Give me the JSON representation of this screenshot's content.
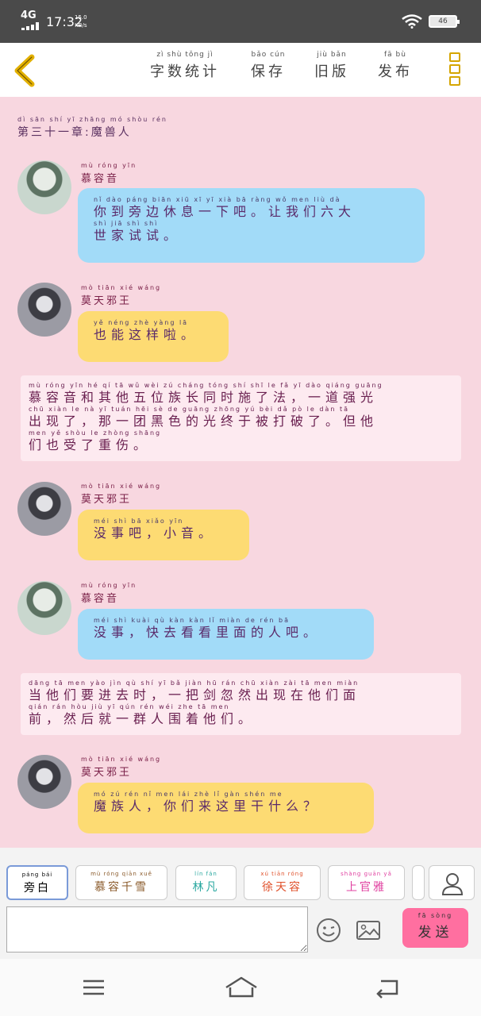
{
  "status_bar": {
    "network": "4G",
    "time": "17:32",
    "speed_value": "15.0",
    "speed_unit": "KB/s",
    "battery": "46"
  },
  "toolbar": {
    "items": [
      {
        "pinyin": "zì  shù  tǒng  jì",
        "label": "字数统计"
      },
      {
        "pinyin": "bǎo  cún",
        "label": "保存"
      },
      {
        "pinyin": "jiù  bǎn",
        "label": "旧版"
      },
      {
        "pinyin": "fā  bù",
        "label": "发布"
      }
    ]
  },
  "chapter": {
    "pinyin": "dì  sān  shí  yī  zhāng  mó  shòu  rén",
    "title": "第三十一章:魔兽人"
  },
  "messages": [
    {
      "speaker_pinyin": "mù  róng  yīn",
      "speaker": "慕容音",
      "lines": [
        {
          "pinyin": "nǐ  dào  páng  biān  xiū  xī  yī  xià  bā    ràng  wǒ  men  liù  dà",
          "text": "你到旁边休息一下吧。让我们六大"
        },
        {
          "pinyin": "shì  jiā  shì  shì",
          "text": "世家试试。"
        }
      ]
    },
    {
      "speaker_pinyin": "mò  tiān  xié  wáng",
      "speaker": "莫天邪王",
      "lines": [
        {
          "pinyin": "yě  néng  zhè  yàng  lā",
          "text": "也能这样啦。"
        }
      ]
    },
    {
      "speaker_pinyin": "mò  tiān  xié  wáng",
      "speaker": "莫天邪王",
      "lines": [
        {
          "pinyin": "méi  shì  bā    xiǎo  yīn",
          "text": "没事吧，小音。"
        }
      ]
    },
    {
      "speaker_pinyin": "mù  róng  yīn",
      "speaker": "慕容音",
      "lines": [
        {
          "pinyin": "méi  shì    kuài  qù  kàn  kàn  lǐ  miàn  de  rén  bā",
          "text": "没事，快去看看里面的人吧。"
        }
      ]
    },
    {
      "speaker_pinyin": "mò  tiān  xié  wáng",
      "speaker": "莫天邪王",
      "lines": [
        {
          "pinyin": "mó  zú  rén    nǐ  men  lái  zhè  lǐ  gàn  shén  me",
          "text": "魔族人，你们来这里干什么？"
        }
      ]
    }
  ],
  "narrations": [
    {
      "lines": [
        {
          "pinyin": "mù  róng  yīn  hé  qí  tā  wǔ  wèi  zú  cháng tóng  shí  shī  le  fǎ    yī  dào  qiáng guāng",
          "text": "慕容音和其他五位族长同时施了法，一道强光"
        },
        {
          "pinyin": "chū  xiàn  le    nà  yī  tuán  hēi  sè  de  guāng zhōng  yú  bèi  dǎ  pò  le    dàn  tā",
          "text": "出现了，那一团黑色的光终于被打破了。但他"
        },
        {
          "pinyin": "men  yě  shòu  le  zhòng shāng",
          "text": "们也受了重伤。"
        }
      ]
    },
    {
      "lines": [
        {
          "pinyin": "dāng  tā  men  yào  jìn  qù  shí    yī  bǎ  jiàn  hū  rán  chū  xiàn  zài  tā  men  miàn",
          "text": "当他们要进去时，一把剑忽然出现在他们面"
        },
        {
          "pinyin": "qián    rán  hòu  jiù  yī  qún  rén  wéi  zhe  tā  men",
          "text": "前，然后就一群人围着他们。"
        }
      ]
    }
  ],
  "roles": [
    {
      "pinyin": "páng  bái",
      "label": "旁白",
      "color": "#333333"
    },
    {
      "pinyin": "mù  róng  qiān  xuě",
      "label": "慕容千雪",
      "color": "#8a5a2a"
    },
    {
      "pinyin": "lín  fán",
      "label": "林凡",
      "color": "#2aa8a0"
    },
    {
      "pinyin": "xú  tiān  róng",
      "label": "徐天容",
      "color": "#e0502a"
    },
    {
      "pinyin": "shàng guān  yǎ",
      "label": "上官雅",
      "color": "#e040a0"
    }
  ],
  "composer": {
    "input_value": "",
    "send_pinyin": "fā  sòng",
    "send_label": "发送"
  },
  "colors": {
    "accent_pink": "#ff6fa0",
    "bubble_blue": "#a2dbf8",
    "bubble_yellow": "#fddb73",
    "chat_bg": "#f8d7e0",
    "toolbar_icon": "#d5a500"
  },
  "icons": {
    "back": "chevron-left-icon",
    "menu": "menu-dots-icon",
    "person": "person-icon",
    "emoji": "smiley-icon",
    "image": "image-icon",
    "nav_menu": "hamburger-icon",
    "nav_home": "home-icon",
    "nav_back": "back-arrow-icon"
  }
}
